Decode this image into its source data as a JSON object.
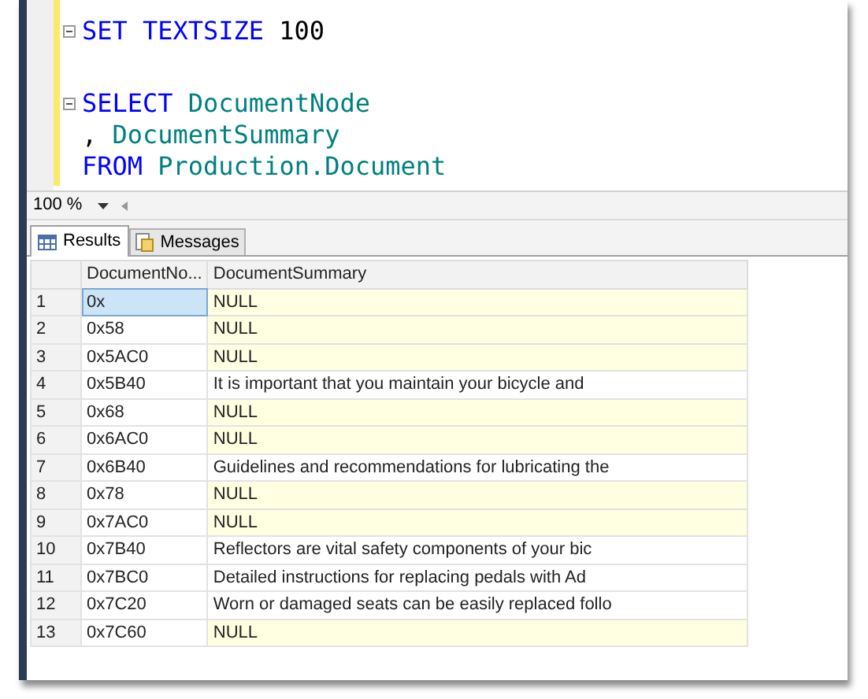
{
  "editor": {
    "lines": [
      {
        "fold": true,
        "blank_before": false,
        "tokens": [
          {
            "text": "SET",
            "kind": "keyword"
          },
          {
            "text": "TEXTSIZE",
            "kind": "keyword"
          },
          {
            "text": "100",
            "kind": "number"
          }
        ]
      },
      {
        "fold": true,
        "blank_before": true,
        "tokens": [
          {
            "text": "SELECT",
            "kind": "keyword"
          },
          {
            "text": "DocumentNode",
            "kind": "identifier"
          }
        ]
      },
      {
        "fold": false,
        "blank_before": false,
        "tokens": [
          {
            "text": ",",
            "kind": "number"
          },
          {
            "text": "DocumentSummary",
            "kind": "identifier"
          }
        ]
      },
      {
        "fold": false,
        "blank_before": false,
        "tokens": [
          {
            "text": "FROM",
            "kind": "keyword"
          },
          {
            "text": "Production.Document",
            "kind": "identifier"
          }
        ]
      }
    ]
  },
  "zoom": {
    "value": "100 %"
  },
  "tabs": [
    {
      "label": "Results",
      "selected": true,
      "kind": "grid"
    },
    {
      "label": "Messages",
      "selected": false,
      "kind": "messages"
    }
  ],
  "grid": {
    "columns": [
      "DocumentNo...",
      "DocumentSummary"
    ],
    "rows": [
      {
        "number": "1",
        "node": "0x",
        "summary": "NULL",
        "is_null": true,
        "selected": true
      },
      {
        "number": "2",
        "node": "0x58",
        "summary": "NULL",
        "is_null": true,
        "selected": false
      },
      {
        "number": "3",
        "node": "0x5AC0",
        "summary": "NULL",
        "is_null": true,
        "selected": false
      },
      {
        "number": "4",
        "node": "0x5B40",
        "summary": "It is important that you maintain your bicycle and",
        "is_null": false,
        "selected": false
      },
      {
        "number": "5",
        "node": "0x68",
        "summary": "NULL",
        "is_null": true,
        "selected": false
      },
      {
        "number": "6",
        "node": "0x6AC0",
        "summary": "NULL",
        "is_null": true,
        "selected": false
      },
      {
        "number": "7",
        "node": "0x6B40",
        "summary": "Guidelines and recommendations for lubricating the",
        "is_null": false,
        "selected": false
      },
      {
        "number": "8",
        "node": "0x78",
        "summary": "NULL",
        "is_null": true,
        "selected": false
      },
      {
        "number": "9",
        "node": "0x7AC0",
        "summary": "NULL",
        "is_null": true,
        "selected": false
      },
      {
        "number": "10",
        "node": "0x7B40",
        "summary": "Reflectors are vital safety components of your bic",
        "is_null": false,
        "selected": false
      },
      {
        "number": "11",
        "node": "0x7BC0",
        "summary": "Detailed instructions for replacing pedals with Ad",
        "is_null": false,
        "selected": false
      },
      {
        "number": "12",
        "node": "0x7C20",
        "summary": "Worn or damaged seats can be easily replaced follo",
        "is_null": false,
        "selected": false
      },
      {
        "number": "13",
        "node": "0x7C60",
        "summary": "NULL",
        "is_null": true,
        "selected": false
      }
    ]
  }
}
